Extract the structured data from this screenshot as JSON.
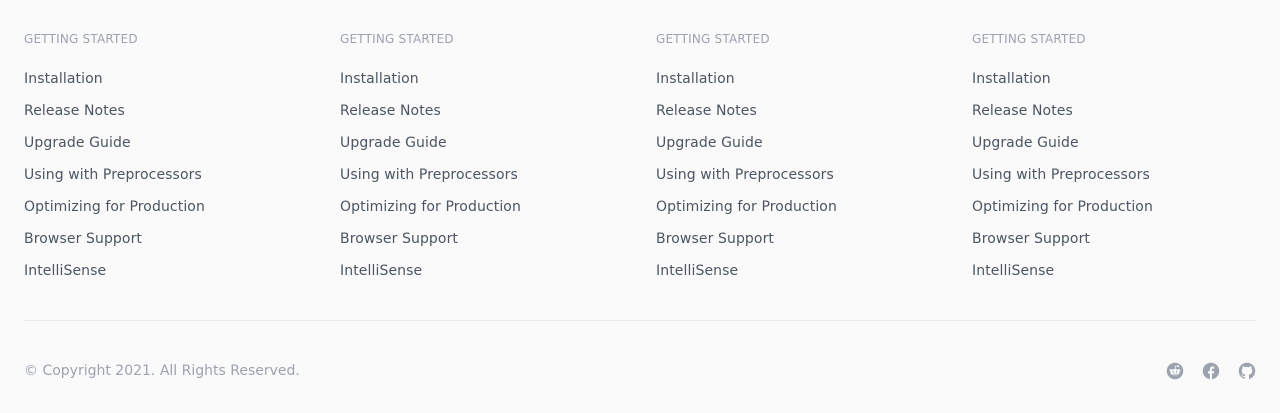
{
  "colors": {
    "background": "#fafafa",
    "heading": "#9ca3af",
    "link": "#4b5563",
    "muted": "#9ca3af",
    "divider": "#e5e7eb",
    "icon": "#9ca3af"
  },
  "columns": [
    {
      "heading": "GETTING STARTED",
      "links": [
        "Installation",
        "Release Notes",
        "Upgrade Guide",
        "Using with Preprocessors",
        "Optimizing for Production",
        "Browser Support",
        "IntelliSense"
      ]
    },
    {
      "heading": "GETTING STARTED",
      "links": [
        "Installation",
        "Release Notes",
        "Upgrade Guide",
        "Using with Preprocessors",
        "Optimizing for Production",
        "Browser Support",
        "IntelliSense"
      ]
    },
    {
      "heading": "GETTING STARTED",
      "links": [
        "Installation",
        "Release Notes",
        "Upgrade Guide",
        "Using with Preprocessors",
        "Optimizing for Production",
        "Browser Support",
        "IntelliSense"
      ]
    },
    {
      "heading": "GETTING STARTED",
      "links": [
        "Installation",
        "Release Notes",
        "Upgrade Guide",
        "Using with Preprocessors",
        "Optimizing for Production",
        "Browser Support",
        "IntelliSense"
      ]
    }
  ],
  "footer": {
    "copyright": "© Copyright 2021. All Rights Reserved.",
    "social": [
      {
        "icon": "reddit-icon"
      },
      {
        "icon": "facebook-icon"
      },
      {
        "icon": "github-icon"
      }
    ]
  }
}
